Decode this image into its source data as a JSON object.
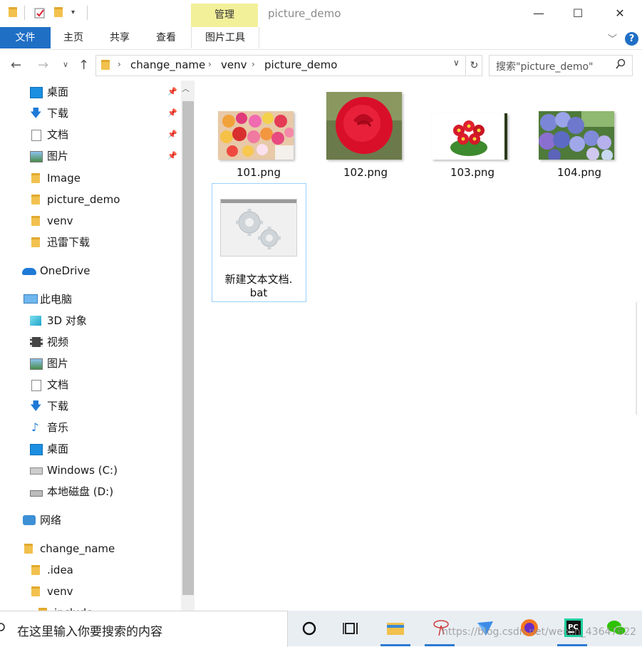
{
  "window": {
    "title": "picture_demo",
    "manage_tab": "管理",
    "controls": {
      "minimize": "—",
      "maximize": "☐",
      "close": "✕"
    }
  },
  "ribbon": {
    "tabs": [
      "文件",
      "主页",
      "共享",
      "查看",
      "图片工具"
    ],
    "help": "?"
  },
  "address": {
    "crumbs": [
      "change_name",
      "venv",
      "picture_demo"
    ],
    "search_placeholder": "搜索\"picture_demo\""
  },
  "nav": {
    "quick_access": [
      {
        "label": "桌面",
        "icon": "desktop-icon",
        "pinned": true
      },
      {
        "label": "下载",
        "icon": "download-icon",
        "pinned": true
      },
      {
        "label": "文档",
        "icon": "document-icon",
        "pinned": true
      },
      {
        "label": "图片",
        "icon": "picture-icon",
        "pinned": true
      },
      {
        "label": "Image",
        "icon": "folder-icon",
        "pinned": false
      },
      {
        "label": "picture_demo",
        "icon": "folder-icon",
        "pinned": false
      },
      {
        "label": "venv",
        "icon": "folder-icon",
        "pinned": false
      },
      {
        "label": "迅雷下载",
        "icon": "folder-icon",
        "pinned": false
      }
    ],
    "onedrive": "OneDrive",
    "this_pc": "此电脑",
    "pc_items": [
      {
        "label": "3D 对象",
        "icon": "3d-objects-icon"
      },
      {
        "label": "视频",
        "icon": "video-icon"
      },
      {
        "label": "图片",
        "icon": "picture-icon"
      },
      {
        "label": "文档",
        "icon": "document-icon"
      },
      {
        "label": "下载",
        "icon": "download-icon"
      },
      {
        "label": "音乐",
        "icon": "music-icon"
      },
      {
        "label": "桌面",
        "icon": "desktop-icon"
      },
      {
        "label": "Windows (C:)",
        "icon": "windows-drive-icon"
      },
      {
        "label": "本地磁盘 (D:)",
        "icon": "drive-icon"
      }
    ],
    "network": "网络",
    "tree": [
      {
        "label": "change_name",
        "indent": 1
      },
      {
        "label": ".idea",
        "indent": 2
      },
      {
        "label": "venv",
        "indent": 2
      },
      {
        "label": "include",
        "indent": 3
      }
    ]
  },
  "files": [
    {
      "name": "101.png",
      "thumb": "flower-bouquet"
    },
    {
      "name": "102.png",
      "thumb": "red-rose"
    },
    {
      "name": "103.png",
      "thumb": "red-primula"
    },
    {
      "name": "104.png",
      "thumb": "hydrangea"
    },
    {
      "name_line1": "新建文本文档.",
      "name_line2": "bat",
      "thumb": "batch-file"
    }
  ],
  "taskbar": {
    "search_placeholder": "在这里输入你要搜索的内容",
    "watermark": "https://blog.csdn.net/weixin_43647622"
  }
}
